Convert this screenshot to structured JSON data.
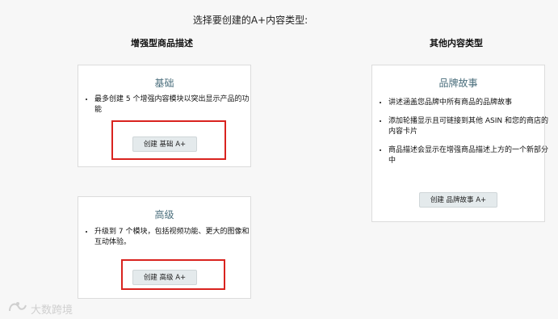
{
  "header": {
    "prompt": "选择要创建的A+内容类型:"
  },
  "columns": {
    "enhanced": {
      "title": "增强型商品描述"
    },
    "other": {
      "title": "其他内容类型"
    }
  },
  "cards": {
    "basic": {
      "title": "基础",
      "bullets": [
        "最多创建 5 个增强内容模块以突出显示产品的功能"
      ],
      "button_label": "创建 基础 A+"
    },
    "premium": {
      "title": "高级",
      "bullets": [
        "升级到 7 个模块，包括视频功能、更大的图像和互动体验。"
      ],
      "button_label": "创建 高级 A+"
    },
    "brand_story": {
      "title": "品牌故事",
      "bullets": [
        "讲述涵盖您品牌中所有商品的品牌故事",
        "添加轮播显示且可链接到其他 ASIN 和您的商店的内容卡片",
        "商品描述会显示在增强商品描述上方的一个新部分中"
      ],
      "button_label": "创建 品牌故事 A+"
    }
  },
  "watermark": {
    "text": "大数跨境"
  },
  "colors": {
    "highlight": "#d9231f",
    "card_title": "#4a6e7c",
    "button_bg": "#e4eaec"
  }
}
